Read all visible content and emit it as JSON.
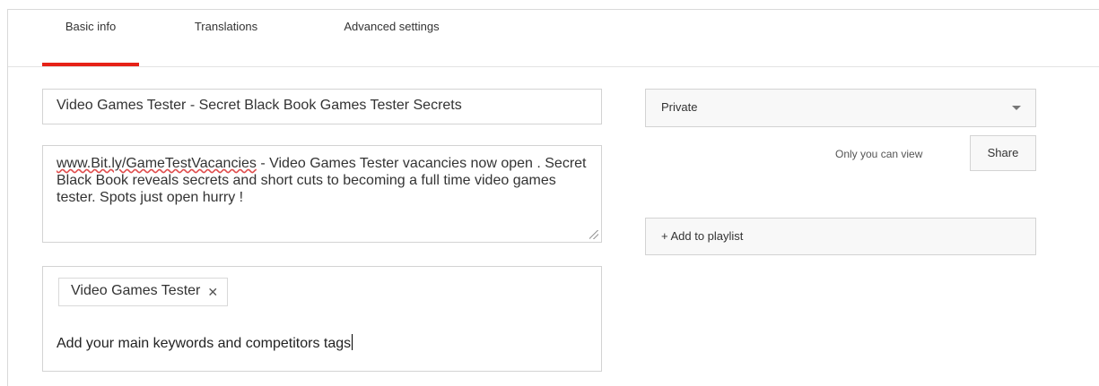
{
  "tabs": [
    {
      "label": "Basic info",
      "active": true
    },
    {
      "label": "Translations",
      "active": false
    },
    {
      "label": "Advanced settings",
      "active": false
    }
  ],
  "accent_color": "#e62117",
  "title": {
    "value": "Video Games Tester - Secret Black Book Games Tester Secrets"
  },
  "description": {
    "link_text": "www.Bit.ly/GameTestVacancies",
    "body_text": " - Video Games Tester vacancies now open . Secret Black Book reveals secrets and short cuts to becoming a full time video games tester. Spots just open hurry !"
  },
  "tags": {
    "chips": [
      {
        "label": "Video Games Tester",
        "remove_icon": "close-icon"
      }
    ],
    "entry_text": "Add your main keywords and competitors tags"
  },
  "privacy": {
    "selected": "Private",
    "hint": "Only you can view",
    "share_label": "Share"
  },
  "playlist": {
    "label": "+ Add to playlist"
  }
}
